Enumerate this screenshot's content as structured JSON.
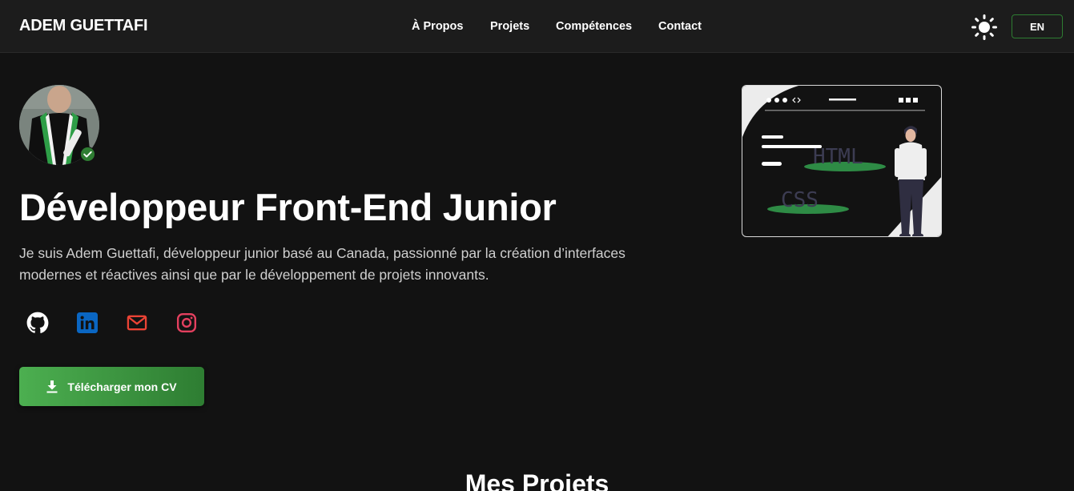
{
  "header": {
    "brand": "ADEM GUETTAFI",
    "nav": [
      {
        "label": "À Propos"
      },
      {
        "label": "Projets"
      },
      {
        "label": "Compétences"
      },
      {
        "label": "Contact"
      }
    ],
    "theme_icon": "sun-icon",
    "lang_label": "EN"
  },
  "hero": {
    "avatar_icon": "profile-photo",
    "verified_icon": "check-circle-icon",
    "title": "Développeur Front-End Junior",
    "description": "Je suis Adem Guettafi, développeur junior basé au Canada, passionné par la création d’interfaces modernes et réactives ainsi que par le développement de projets innovants.",
    "socials": [
      {
        "icon": "github-icon"
      },
      {
        "icon": "linkedin-icon"
      },
      {
        "icon": "mail-icon"
      },
      {
        "icon": "instagram-icon"
      }
    ],
    "cv_button": "Télécharger mon CV",
    "cv_icon": "download-icon",
    "illustration": {
      "html_text": "HTML",
      "css_text": "CSS"
    }
  },
  "projects": {
    "title": "Mes Projets"
  },
  "colors": {
    "background": "#121212",
    "header": "#1c1c1c",
    "accent": "#2e7d32",
    "accent_light": "#4caf50",
    "linkedin": "#0a66c2",
    "mail": "#ea4335",
    "instagram": "#e4405f"
  }
}
